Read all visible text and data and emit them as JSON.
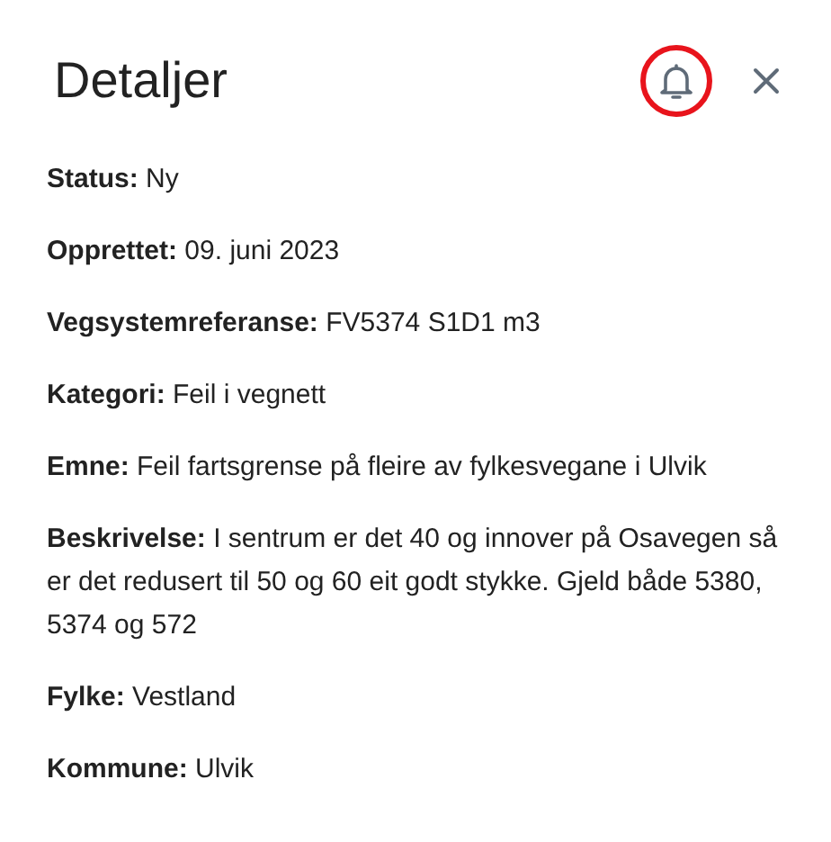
{
  "header": {
    "title": "Detaljer",
    "bell_highlighted": true
  },
  "fields": [
    {
      "label": "Status:",
      "value": "Ny"
    },
    {
      "label": "Opprettet:",
      "value": "09. juni 2023"
    },
    {
      "label": "Vegsystemreferanse:",
      "value": "FV5374 S1D1 m3"
    },
    {
      "label": "Kategori:",
      "value": "Feil i vegnett"
    },
    {
      "label": "Emne:",
      "value": "Feil fartsgrense på fleire av fylkesvegane i Ulvik"
    },
    {
      "label": "Beskrivelse:",
      "value": "I sentrum er det 40 og innover på Osavegen så er det redusert til 50 og 60 eit godt stykke. Gjeld både 5380, 5374 og 572"
    },
    {
      "label": "Fylke:",
      "value": "Vestland"
    },
    {
      "label": "Kommune:",
      "value": "Ulvik"
    }
  ]
}
